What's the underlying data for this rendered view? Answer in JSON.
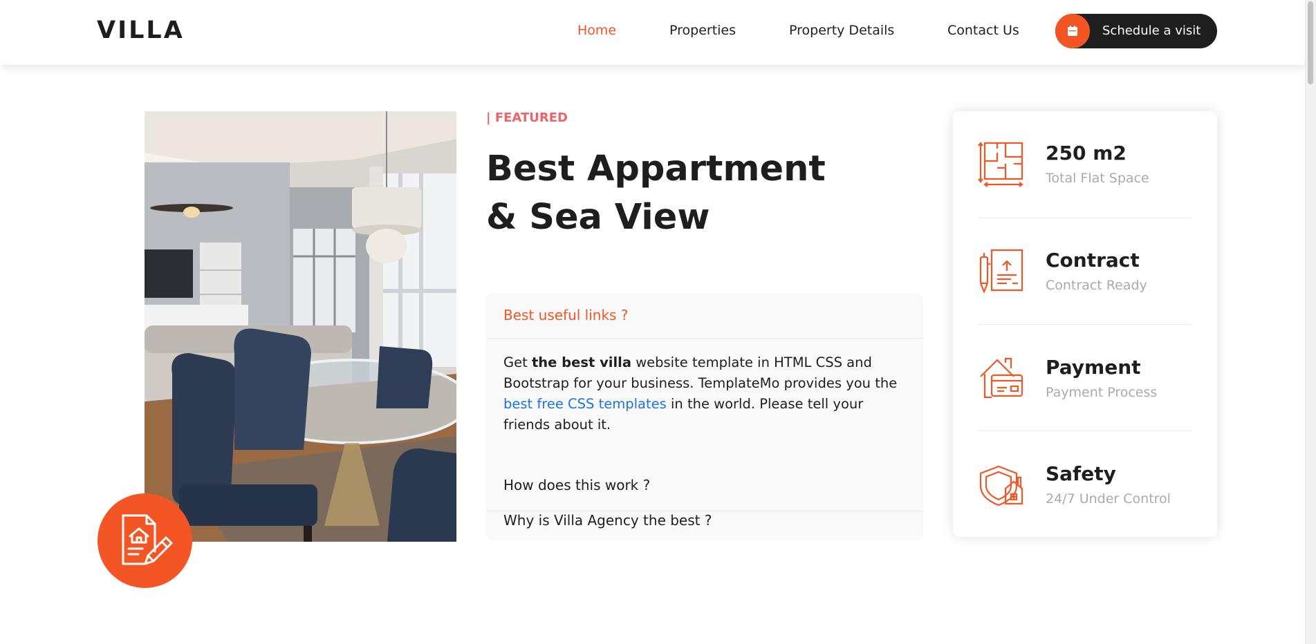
{
  "header": {
    "logo": "VILLA",
    "nav": [
      {
        "label": "Home",
        "active": true
      },
      {
        "label": "Properties",
        "active": false
      },
      {
        "label": "Property Details",
        "active": false
      },
      {
        "label": "Contact Us",
        "active": false
      }
    ],
    "visit_button": {
      "label": "Schedule a visit",
      "icon": "calendar-icon"
    }
  },
  "main": {
    "featured_label": "| FEATURED",
    "title_line1": "Best Appartment",
    "title_line2": "& Sea View",
    "fab_icon": "document-house-pen-icon",
    "accordion": {
      "open": {
        "question": "Best useful links ?",
        "answer_pre": "Get ",
        "answer_bold": "the best villa",
        "answer_mid": " website template in HTML CSS and Bootstrap for your business. TemplateMo provides you the ",
        "answer_link": "best free CSS templates",
        "answer_post": " in the world. Please tell your friends about it."
      },
      "q2": "How does this work ?",
      "q3": "Why is Villa Agency the best ?"
    }
  },
  "info": [
    {
      "value": "250 m2",
      "label": "Total Flat Space",
      "icon": "floor-plan-icon"
    },
    {
      "value": "Contract",
      "label": "Contract Ready",
      "icon": "contract-icon"
    },
    {
      "value": "Payment",
      "label": "Payment Process",
      "icon": "payment-card-icon"
    },
    {
      "value": "Safety",
      "label": "24/7 Under Control",
      "icon": "shield-house-icon"
    }
  ],
  "colors": {
    "accent": "#f35525",
    "dark": "#1e1e1e",
    "featured": "#ee626b",
    "link": "#1d74e0",
    "muted": "#aaaaaa"
  }
}
